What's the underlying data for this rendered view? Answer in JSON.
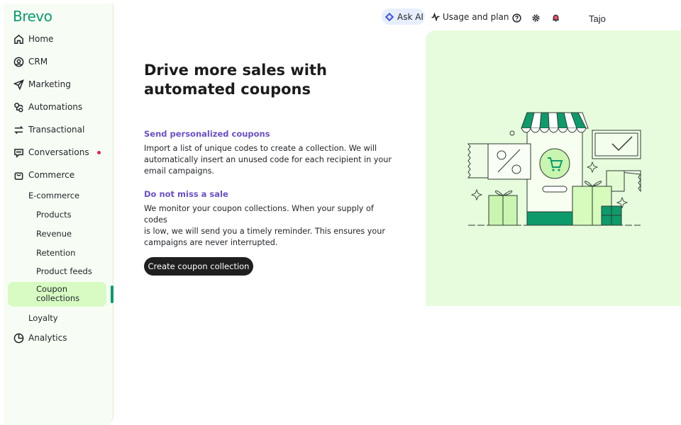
{
  "brand": {
    "logo": "Brevo",
    "accent": "#0b996e"
  },
  "sidebar": {
    "items": [
      {
        "label": "Home",
        "icon": "home-icon"
      },
      {
        "label": "CRM",
        "icon": "contact-icon"
      },
      {
        "label": "Marketing",
        "icon": "send-icon"
      },
      {
        "label": "Automations",
        "icon": "automation-icon"
      },
      {
        "label": "Transactional",
        "icon": "transactional-icon"
      },
      {
        "label": "Conversations",
        "icon": "chat-icon",
        "badge": "dot"
      },
      {
        "label": "Commerce",
        "icon": "bag-icon"
      }
    ],
    "commerce_sub": {
      "ecommerce": "E-commerce",
      "products": "Products",
      "revenue": "Revenue",
      "retention": "Retention",
      "product_feeds": "Product feeds",
      "coupon_collections_line1": "Coupon",
      "coupon_collections_line2": "collections"
    },
    "loyalty": "Loyalty",
    "analytics": {
      "label": "Analytics",
      "icon": "pie-chart-icon"
    },
    "active": "Coupon collections"
  },
  "topbar": {
    "ask_ai": "Ask AI",
    "usage": "Usage and plan",
    "user": "Tajo",
    "icons": [
      "help-icon",
      "gear-icon",
      "bell-icon"
    ]
  },
  "main": {
    "headline_line1": "Drive more sales with",
    "headline_line2": "automated coupons",
    "section1_title": "Send personalized coupons",
    "section1_line1": "Import a list of unique codes to create a collection. We will",
    "section1_line2": "automatically insert an unused code for each recipient in your",
    "section1_line3": "email campaigns.",
    "section2_title": "Do not miss a sale",
    "section2_line1": "We monitor your coupon collections. When your supply of codes",
    "section2_line2": "is low, we will send you a timely reminder. This ensures your",
    "section2_line3": "campaigns are never interrupted.",
    "cta": "Create coupon collection"
  },
  "colors": {
    "accent": "#0b996e",
    "section_title": "#6a4fc6",
    "panel": "#e7fcdc",
    "active_pill": "#d8fbc4"
  }
}
